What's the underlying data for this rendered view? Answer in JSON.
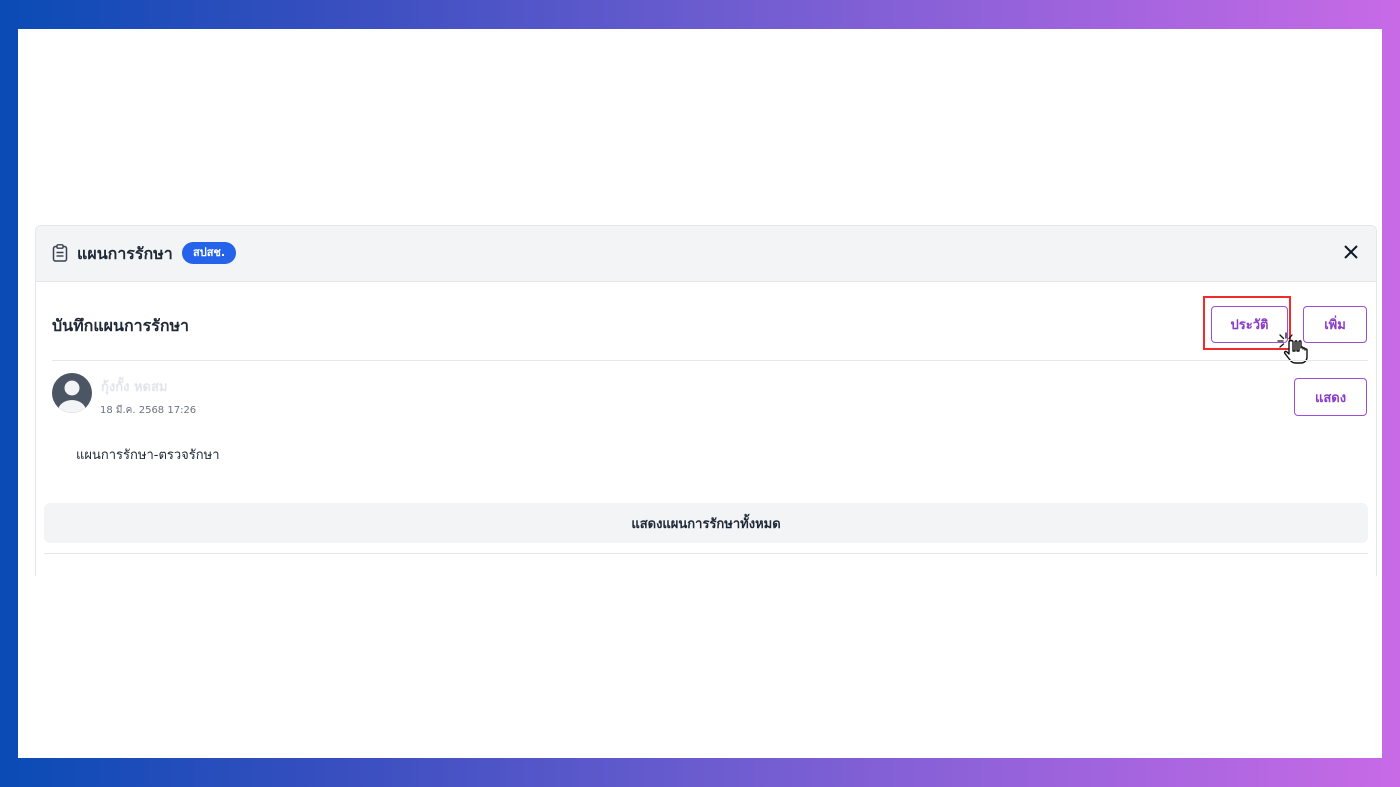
{
  "header": {
    "title": "แผนการรักษา",
    "tag": "สปสช.",
    "icon": "clipboard-icon"
  },
  "section": {
    "title": "บันทึกแผนการรักษา",
    "history_label": "ประวัติ",
    "add_label": "เพิ่ม"
  },
  "entry": {
    "user_name": "กุ้งกั้ง หดสม",
    "timestamp": "18 มี.ค. 2568 17:26",
    "show_label": "แสดง",
    "plan_text": "แผนการรักษา-ตรวจรักษา"
  },
  "footer": {
    "show_all_label": "แสดงแผนการรักษาทั้งหมด"
  },
  "colors": {
    "accent": "#9b4fd6",
    "tag": "#2563eb",
    "highlight": "#ef2b2b"
  }
}
